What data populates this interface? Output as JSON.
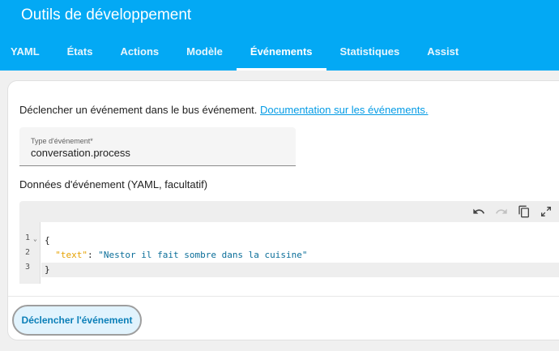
{
  "header": {
    "title": "Outils de développement"
  },
  "tabs": [
    {
      "label": "YAML"
    },
    {
      "label": "États"
    },
    {
      "label": "Actions"
    },
    {
      "label": "Modèle"
    },
    {
      "label": "Événements",
      "active": true
    },
    {
      "label": "Statistiques"
    },
    {
      "label": "Assist"
    }
  ],
  "main": {
    "intro_text": "Déclencher un événement dans le bus événement.",
    "docs_link": "Documentation sur les événements.",
    "event_type": {
      "label": "Type d'événement*",
      "value": "conversation.process"
    },
    "data_label": "Données d'événement (YAML, facultatif)",
    "editor": {
      "line_numbers": [
        "1",
        "2",
        "3"
      ],
      "code": {
        "open": "{",
        "key": "\"text\"",
        "sep": ": ",
        "value": "\"Nestor il fait sombre dans la cuisine\"",
        "close": "}"
      },
      "toolbar_icons": [
        "undo-icon",
        "redo-icon",
        "copy-icon",
        "fullscreen-icon"
      ]
    },
    "fire_button": "Déclencher l'événement"
  },
  "colors": {
    "accent": "#03a9f4",
    "link": "#039be5",
    "yaml_key": "#e6a100",
    "yaml_string": "#0b6e99"
  }
}
